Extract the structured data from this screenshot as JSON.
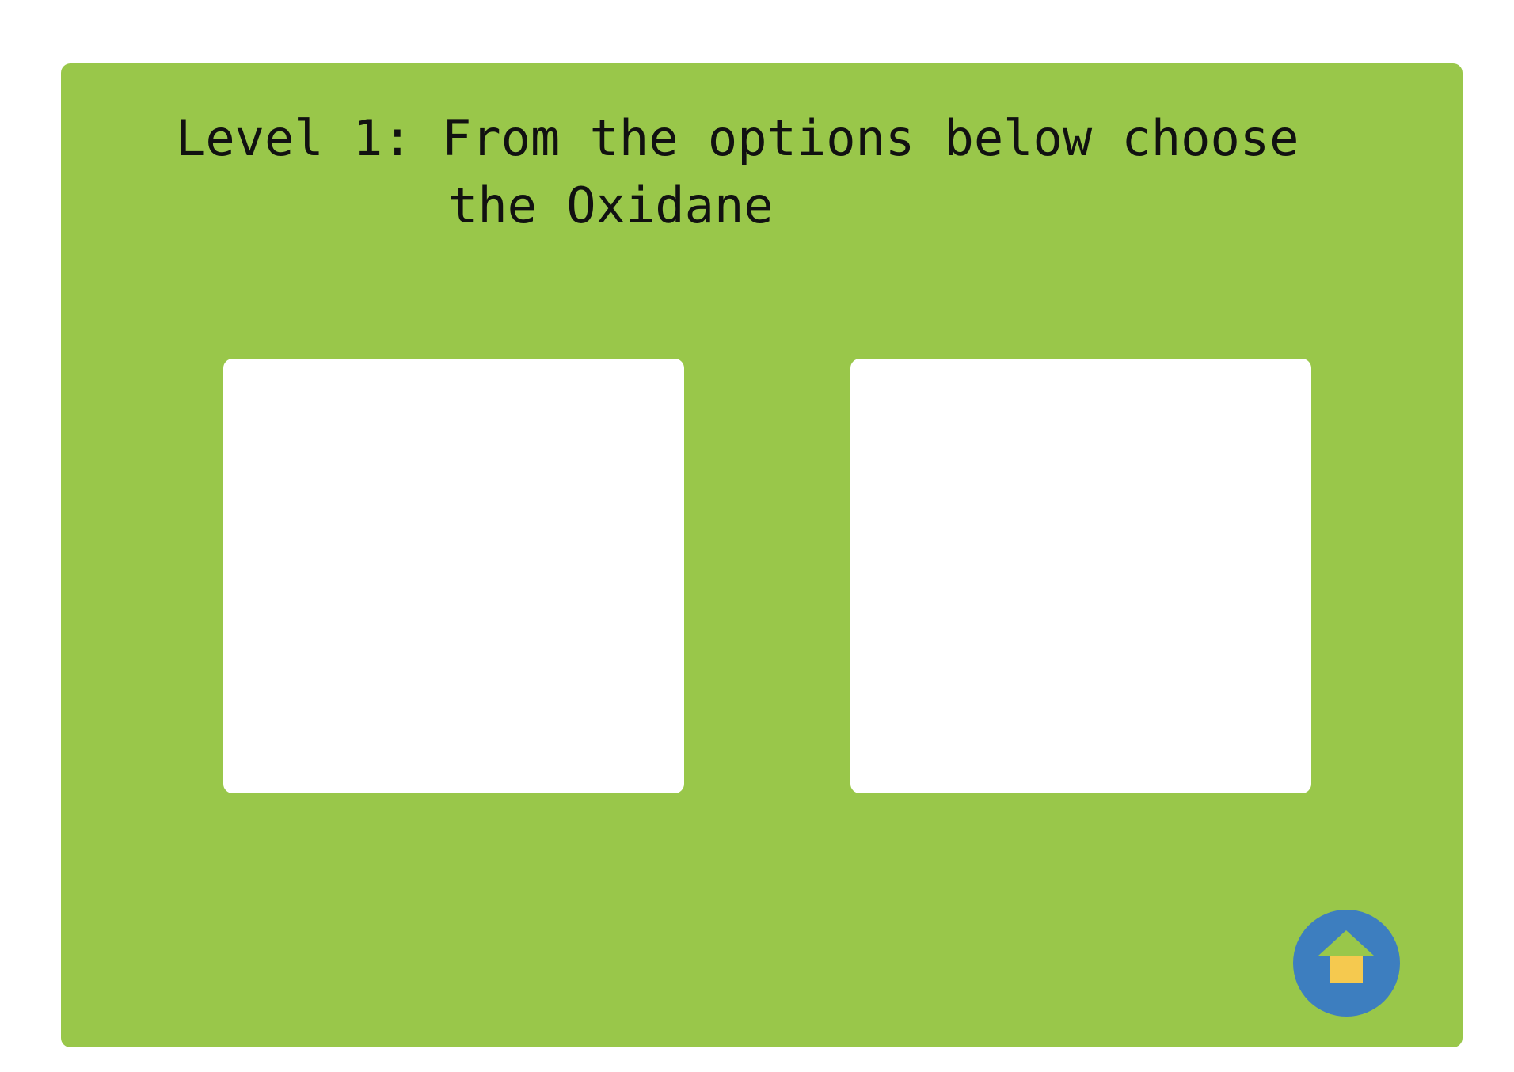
{
  "question": {
    "line1": "Level 1: From the options below choose",
    "line2": "the Oxidane"
  },
  "options": [
    {
      "label": ""
    },
    {
      "label": ""
    }
  ],
  "home_button": {
    "icon": "home-icon"
  },
  "colors": {
    "board": "#99c74a",
    "option_card": "#ffffff",
    "home_button": "#3d7ebf",
    "home_roof": "#99c74a",
    "home_body": "#f5c94f"
  }
}
